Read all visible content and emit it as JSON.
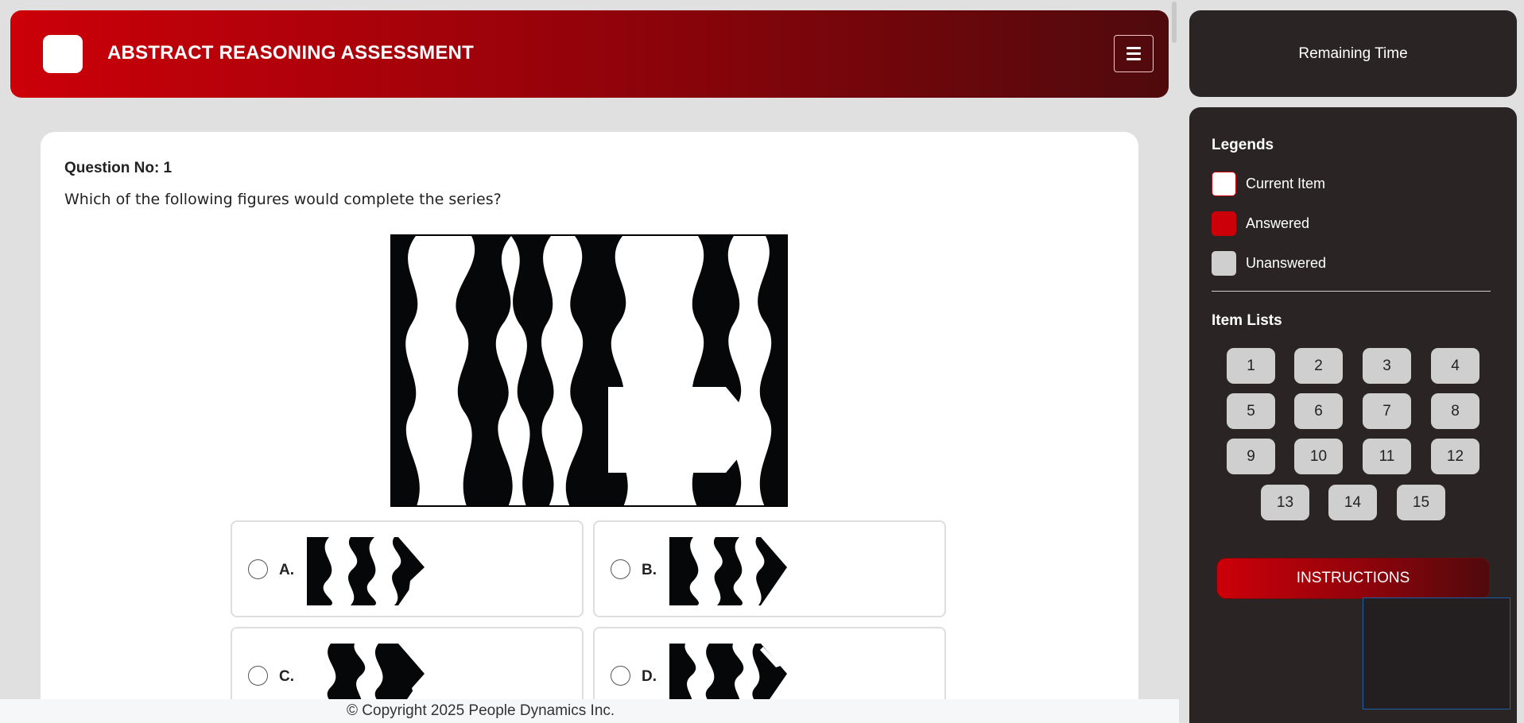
{
  "header": {
    "title": "ABSTRACT REASONING ASSESSMENT",
    "menu_icon": "hamburger-icon"
  },
  "question": {
    "number_label": "Question No: 1",
    "text": "Which of the following figures would complete the series?",
    "options": [
      {
        "letter": "A.",
        "selected": false
      },
      {
        "letter": "B.",
        "selected": false
      },
      {
        "letter": "C.",
        "selected": false
      },
      {
        "letter": "D.",
        "selected": false
      }
    ]
  },
  "timer": {
    "label": "Remaining Time"
  },
  "legends": {
    "heading": "Legends",
    "items": [
      {
        "label": "Current Item",
        "color": "#ffffff",
        "border": "#cc0009"
      },
      {
        "label": "Answered",
        "color": "#cc0009"
      },
      {
        "label": "Unanswered",
        "color": "#cfcfcf"
      }
    ]
  },
  "item_list": {
    "heading": "Item Lists",
    "items": [
      "1",
      "2",
      "3",
      "4",
      "5",
      "6",
      "7",
      "8",
      "9",
      "10",
      "11",
      "12",
      "13",
      "14",
      "15"
    ]
  },
  "instructions_label": "INSTRUCTIONS",
  "footer": {
    "copyright": "© Copyright 2025 People Dynamics Inc."
  },
  "colors": {
    "brand_red": "#cc0009",
    "dark_red": "#4f0a0c",
    "panel_dark": "#2a2425",
    "background": "#e0e0e0"
  }
}
